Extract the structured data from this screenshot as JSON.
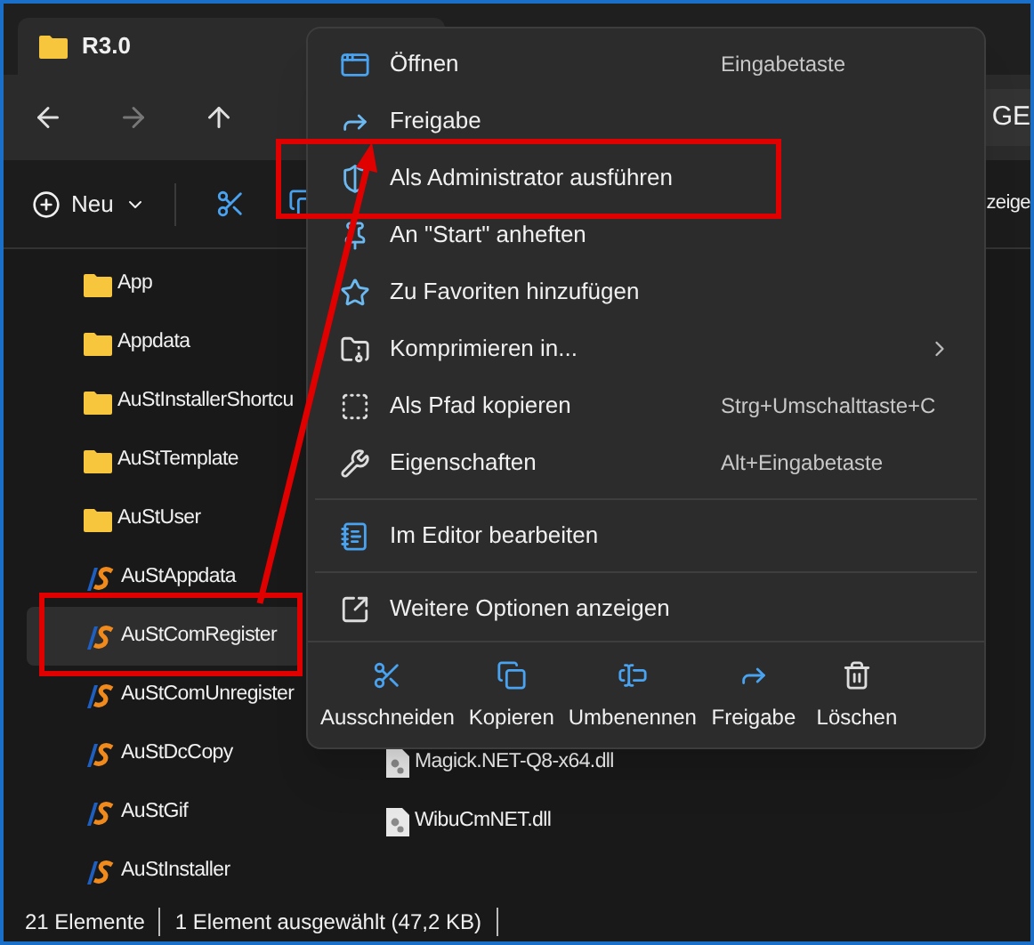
{
  "window": {
    "title": "R3.0"
  },
  "address_bar": {
    "text": "GE"
  },
  "toolbar": {
    "new_button": "Neu",
    "cut_off_label": "zeige"
  },
  "file_columns": [
    [
      {
        "name": "App",
        "kind": "folder",
        "selected": false
      },
      {
        "name": "Appdata",
        "kind": "folder",
        "selected": false
      },
      {
        "name": "AuStInstallerShortcu",
        "kind": "folder",
        "selected": false
      },
      {
        "name": "AuStTemplate",
        "kind": "folder",
        "selected": false
      },
      {
        "name": "AuStUser",
        "kind": "folder",
        "selected": false
      },
      {
        "name": "AuStAppdata",
        "kind": "app",
        "selected": false
      },
      {
        "name": "AuStComRegister",
        "kind": "app",
        "selected": true
      },
      {
        "name": "AuStComUnregister",
        "kind": "app",
        "selected": false
      },
      {
        "name": "AuStDcCopy",
        "kind": "app",
        "selected": false
      },
      {
        "name": "AuStGif",
        "kind": "app",
        "selected": false
      },
      {
        "name": "AuStInstaller",
        "kind": "app",
        "selected": false
      }
    ],
    [
      {
        "name": "Magick.NET-Q8-x64.dll",
        "kind": "dll",
        "selected": false
      },
      {
        "name": "WibuCmNET.dll",
        "kind": "dll",
        "selected": false
      }
    ]
  ],
  "context_menu": {
    "items": [
      {
        "kind": "item",
        "label": "Öffnen",
        "shortcut": "Eingabetaste"
      },
      {
        "kind": "item",
        "label": "Freigabe"
      },
      {
        "kind": "item",
        "label": "Als Administrator ausführen"
      },
      {
        "kind": "item",
        "label": "An \"Start\" anheften"
      },
      {
        "kind": "item",
        "label": "Zu Favoriten hinzufügen"
      },
      {
        "kind": "item",
        "label": "Komprimieren in...",
        "submenu": true
      },
      {
        "kind": "item",
        "label": "Als Pfad kopieren",
        "shortcut": "Strg+Umschalttaste+C"
      },
      {
        "kind": "item",
        "label": "Eigenschaften",
        "shortcut": "Alt+Eingabetaste"
      },
      {
        "kind": "separator"
      },
      {
        "kind": "item",
        "label": "Im Editor bearbeiten"
      },
      {
        "kind": "separator"
      },
      {
        "kind": "item",
        "label": "Weitere Optionen anzeigen"
      }
    ],
    "actions": [
      "Ausschneiden",
      "Kopieren",
      "Umbenennen",
      "Freigabe",
      "Löschen"
    ]
  },
  "status_bar": {
    "count": "21 Elemente",
    "selection": "1 Element ausgewählt (47,2 KB)"
  }
}
